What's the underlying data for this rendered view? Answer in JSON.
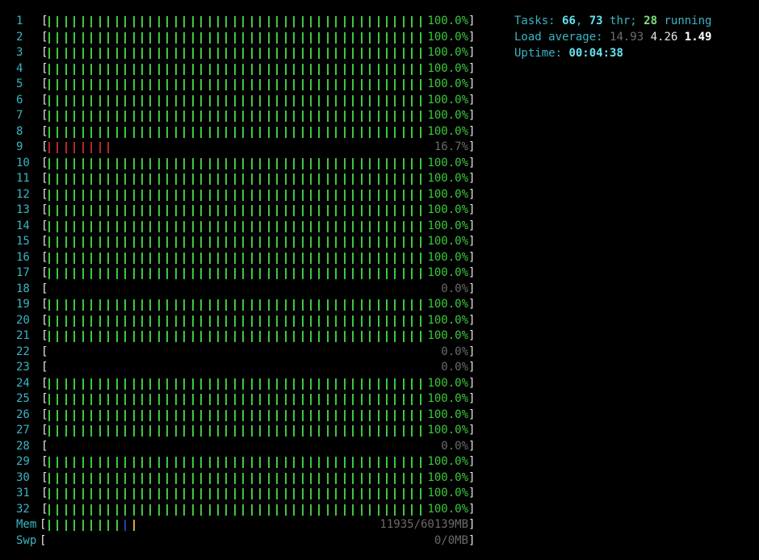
{
  "colors": {
    "label": "#3ab5c2",
    "bar_green": "#3cc83c",
    "bar_red": "#b02a2a",
    "mem_blue": "#2c3aa8",
    "mem_yellow": "#c8a836",
    "value_grey": "#6a6a6a"
  },
  "cpus": [
    {
      "label": "1",
      "value": "100.0%",
      "usage": 100,
      "color": "green"
    },
    {
      "label": "2",
      "value": "100.0%",
      "usage": 100,
      "color": "green"
    },
    {
      "label": "3",
      "value": "100.0%",
      "usage": 100,
      "color": "green"
    },
    {
      "label": "4",
      "value": "100.0%",
      "usage": 100,
      "color": "green"
    },
    {
      "label": "5",
      "value": "100.0%",
      "usage": 100,
      "color": "green"
    },
    {
      "label": "6",
      "value": "100.0%",
      "usage": 100,
      "color": "green"
    },
    {
      "label": "7",
      "value": "100.0%",
      "usage": 100,
      "color": "green"
    },
    {
      "label": "8",
      "value": "100.0%",
      "usage": 100,
      "color": "green"
    },
    {
      "label": "9",
      "value": "16.7%",
      "usage": 16.7,
      "color": "red"
    },
    {
      "label": "10",
      "value": "100.0%",
      "usage": 100,
      "color": "green"
    },
    {
      "label": "11",
      "value": "100.0%",
      "usage": 100,
      "color": "green"
    },
    {
      "label": "12",
      "value": "100.0%",
      "usage": 100,
      "color": "green"
    },
    {
      "label": "13",
      "value": "100.0%",
      "usage": 100,
      "color": "green"
    },
    {
      "label": "14",
      "value": "100.0%",
      "usage": 100,
      "color": "green"
    },
    {
      "label": "15",
      "value": "100.0%",
      "usage": 100,
      "color": "green"
    },
    {
      "label": "16",
      "value": "100.0%",
      "usage": 100,
      "color": "green"
    },
    {
      "label": "17",
      "value": "100.0%",
      "usage": 100,
      "color": "green"
    },
    {
      "label": "18",
      "value": "0.0%",
      "usage": 0,
      "color": "green"
    },
    {
      "label": "19",
      "value": "100.0%",
      "usage": 100,
      "color": "green"
    },
    {
      "label": "20",
      "value": "100.0%",
      "usage": 100,
      "color": "green"
    },
    {
      "label": "21",
      "value": "100.0%",
      "usage": 100,
      "color": "green"
    },
    {
      "label": "22",
      "value": "0.0%",
      "usage": 0,
      "color": "green"
    },
    {
      "label": "23",
      "value": "0.0%",
      "usage": 0,
      "color": "green"
    },
    {
      "label": "24",
      "value": "100.0%",
      "usage": 100,
      "color": "green"
    },
    {
      "label": "25",
      "value": "100.0%",
      "usage": 100,
      "color": "green"
    },
    {
      "label": "26",
      "value": "100.0%",
      "usage": 100,
      "color": "green"
    },
    {
      "label": "27",
      "value": "100.0%",
      "usage": 100,
      "color": "green"
    },
    {
      "label": "28",
      "value": "0.0%",
      "usage": 0,
      "color": "green"
    },
    {
      "label": "29",
      "value": "100.0%",
      "usage": 100,
      "color": "green"
    },
    {
      "label": "30",
      "value": "100.0%",
      "usage": 100,
      "color": "green"
    },
    {
      "label": "31",
      "value": "100.0%",
      "usage": 100,
      "color": "green"
    },
    {
      "label": "32",
      "value": "100.0%",
      "usage": 100,
      "color": "green"
    }
  ],
  "mem": {
    "label": "Mem",
    "value": "11935/60139MB",
    "used_fraction": 0.2,
    "buffers_fraction": 0.004,
    "cache_fraction": 0.004
  },
  "swp": {
    "label": "Swp",
    "value": "0/0MB",
    "used_fraction": 0
  },
  "brackets": {
    "open": "[",
    "close": "]"
  },
  "info": {
    "tasks_label": "Tasks: ",
    "tasks": "66",
    "tasks_sep": ", ",
    "threads": "73",
    "threads_label": " thr; ",
    "running": "28",
    "running_label": " running",
    "load_label": "Load average: ",
    "load1": "14.93",
    "load5": "4.26",
    "load15": "1.49",
    "uptime_label": "Uptime: ",
    "uptime": "00:04:38"
  }
}
